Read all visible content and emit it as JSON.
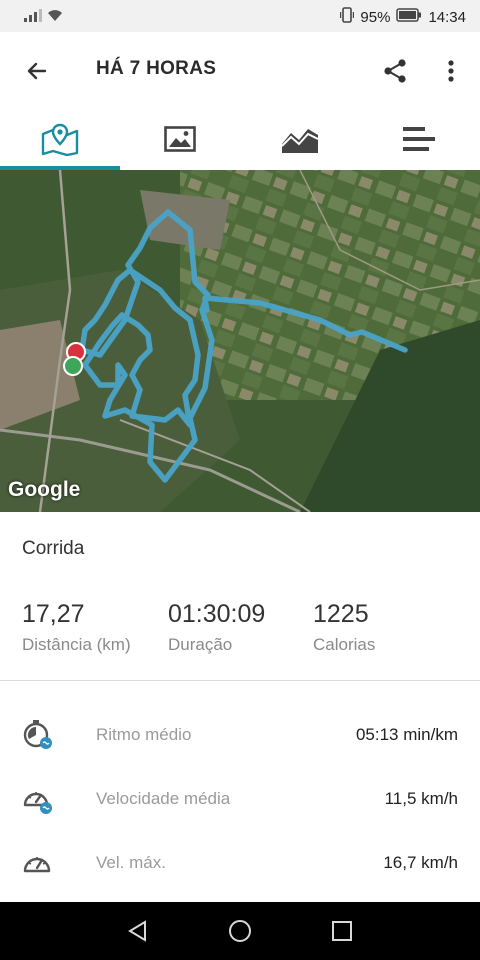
{
  "status_bar": {
    "battery": "95%",
    "time": "14:34"
  },
  "header": {
    "title": "HÁ 7 HORAS"
  },
  "tabs": [
    {
      "name": "map",
      "icon": "map-pin-icon",
      "selected": true
    },
    {
      "name": "photo",
      "icon": "image-icon",
      "selected": false
    },
    {
      "name": "chart",
      "icon": "area-chart-icon",
      "selected": false
    },
    {
      "name": "list",
      "icon": "bars-icon",
      "selected": false
    }
  ],
  "map": {
    "attribution": "Google",
    "route_color": "#4aa3c8"
  },
  "activity": {
    "type": "Corrida"
  },
  "stats": {
    "distance_value": "17,27",
    "distance_label": "Distância (km)",
    "duration_value": "01:30:09",
    "duration_label": "Duração",
    "calories_value": "1225",
    "calories_label": "Calorias"
  },
  "metrics": [
    {
      "label": "Ritmo médio",
      "value": "05:13 min/km",
      "icon": "pace-icon"
    },
    {
      "label": "Velocidade média",
      "value": "11,5 km/h",
      "icon": "speedometer-icon"
    },
    {
      "label": "Vel. máx.",
      "value": "16,7 km/h",
      "icon": "speedometer-max-icon"
    }
  ],
  "colors": {
    "accent": "#1a8ea0",
    "text": "#333333",
    "secondary_text": "#8a8a8a"
  }
}
